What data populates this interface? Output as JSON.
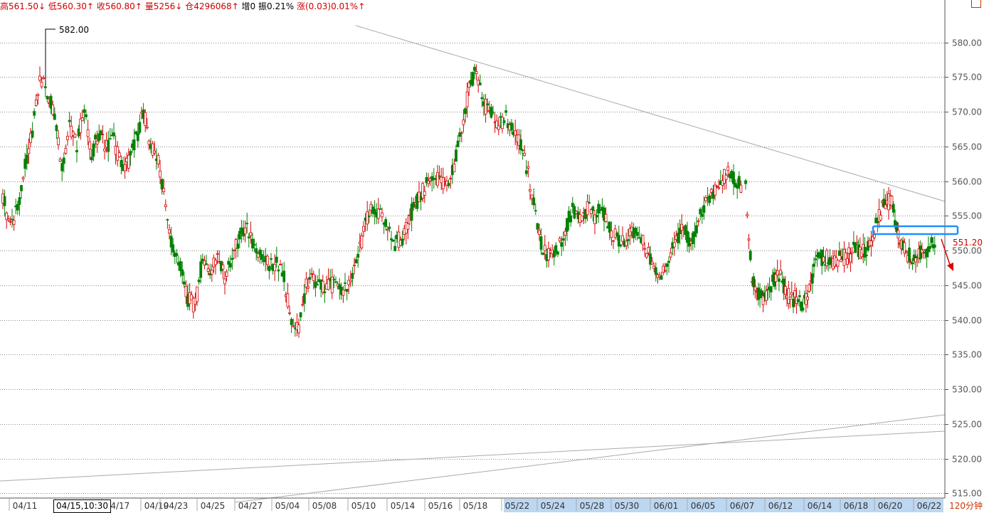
{
  "header": {
    "high_label": "高",
    "high_value": "561.50",
    "high_arrow": "↓",
    "low_label": "低",
    "low_value": "560.30",
    "low_arrow": "↑",
    "close_label": "收",
    "close_value": "560.80",
    "close_arrow": "↑",
    "volume_label": "量",
    "volume_value": "5256",
    "volume_arrow": "↓",
    "oi_label": "仓",
    "oi_value": "4296068",
    "oi_arrow": "↑",
    "increase_label": "增",
    "increase_value": "0",
    "amplitude_label": "振",
    "amplitude_value": "0.21%",
    "change_label": "涨",
    "change_value": "(0.03)0.01%",
    "change_arrow": "↑"
  },
  "cursor_time": "04/15,10:30",
  "period_label": "120分钟",
  "colors": {
    "up": "#d40000",
    "down": "#008000",
    "grid": "#888888",
    "highlight_box": "#1e90ff",
    "arrow": "#e00000"
  },
  "chart_data": {
    "type": "candlestick",
    "ylim": [
      515,
      584
    ],
    "yticks": [
      "515.00",
      "520.00",
      "525.00",
      "530.00",
      "535.00",
      "540.00",
      "545.00",
      "550.00",
      "555.00",
      "560.00",
      "565.00",
      "570.00",
      "575.00",
      "580.00"
    ],
    "ytick_values": [
      515,
      520,
      525,
      530,
      535,
      540,
      545,
      550,
      555,
      560,
      565,
      570,
      575,
      580
    ],
    "xticks": [
      "04/11",
      "04/15",
      "04/17",
      "04/19",
      "04/23",
      "04/25",
      "04/27",
      "05/04",
      "05/08",
      "05/10",
      "05/14",
      "05/16",
      "05/18",
      "05/22",
      "05/24",
      "05/28",
      "05/30",
      "06/01",
      "06/05",
      "06/07",
      "06/12",
      "06/14",
      "06/18",
      "06/20",
      "06/22"
    ],
    "highlighted_xticks": [
      "05/22",
      "05/24",
      "05/28",
      "05/30",
      "06/01",
      "06/05",
      "06/07",
      "06/12",
      "06/14",
      "06/18",
      "06/20",
      "06/22"
    ],
    "annotations": {
      "max_label": "582.00",
      "max_value": 582.0,
      "last_label": "551.20",
      "last_value": 551.2
    },
    "path": [
      558,
      553,
      556,
      562,
      567,
      575,
      573,
      570,
      562,
      568,
      565,
      571,
      564,
      567,
      565,
      566,
      562,
      563,
      566,
      570,
      565,
      563,
      556,
      550,
      548,
      543,
      542,
      549,
      547,
      549,
      546,
      549,
      552,
      553,
      550,
      549,
      548,
      548,
      546,
      540,
      539,
      545,
      546,
      545,
      545,
      545,
      544,
      545,
      549,
      554,
      556,
      555,
      553,
      551,
      552,
      555,
      557,
      559,
      561,
      560,
      559,
      562,
      568,
      573,
      576,
      571,
      570,
      568,
      569,
      567,
      565,
      561,
      555,
      550,
      549,
      550,
      553,
      556,
      555,
      556,
      555,
      556,
      553,
      552,
      551,
      553,
      552,
      550,
      548,
      546,
      549,
      552,
      553,
      551,
      554,
      557,
      558,
      560,
      561,
      560,
      559,
      546,
      544,
      543,
      545,
      547,
      545,
      543,
      543,
      542,
      544,
      548,
      549,
      549,
      548,
      549,
      549,
      550,
      550,
      550,
      552,
      555,
      557,
      557,
      552,
      550,
      549,
      549,
      550,
      550.5,
      551.2
    ],
    "gap_after_index": 100
  }
}
